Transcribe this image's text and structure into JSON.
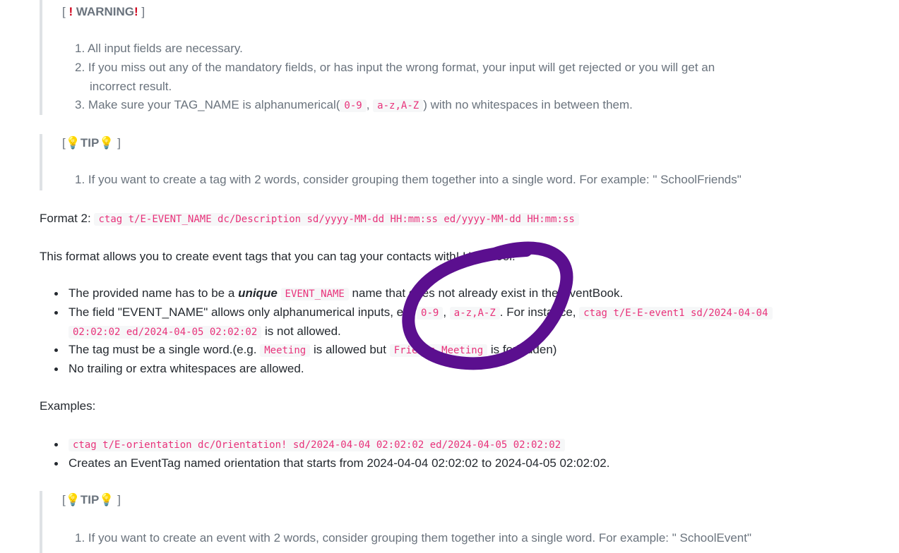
{
  "warning": {
    "title": "WARNING",
    "items": [
      "All input fields are necessary.",
      "If you miss out any of the mandatory fields, or has input the wrong format, your input will get rejected or you will get an",
      "incorrect result.",
      "Make sure your TAG_NAME is alphanumerical(",
      "0-9",
      "a-z,A-Z",
      ") with no whitespaces in between them."
    ]
  },
  "tip1": {
    "title": "TIP",
    "item": "If you want to create a tag with 2 words, consider grouping them together into a single word. For example: \" SchoolFriends\""
  },
  "format2": {
    "label": "Format 2:",
    "code": "ctag t/E-EVENT_NAME dc/Description sd/yyyy-MM-dd HH:mm:ss ed/yyyy-MM-dd HH:mm:ss"
  },
  "intro": "This format allows you to create event tags that you can tag your contacts with! How cool!",
  "bullets": {
    "b1_pre": "The provided name has to be a",
    "b1_em": "unique",
    "b1_code": "EVENT_NAME",
    "b1_post": "name that does not already exist in the EventBook.",
    "b2_pre": "The field \"EVENT_NAME\" allows only alphanumerical inputs, eg.",
    "b2_code1": "0-9",
    "b2_code2": "a-z,A-Z",
    "b2_mid": ". For instance,",
    "b2_code3": "ctag t/E-E-event1 sd/2024-04-04",
    "b2_code4": "02:02:02 ed/2024-04-05 02:02:02",
    "b2_post": "is not allowed.",
    "b3_pre": "The tag must be a single word.(e.g.",
    "b3_code1": "Meeting",
    "b3_mid": "is allowed but",
    "b3_code2": "Friends Meeting",
    "b3_post": "is forbidden)",
    "b4": "No trailing or extra whitespaces are allowed."
  },
  "examples": {
    "label": "Examples:",
    "code": "ctag t/E-orientation dc/Orientation! sd/2024-04-04 02:02:02 ed/2024-04-05 02:02:02",
    "desc": "Creates an EventTag named orientation that starts from 2024-04-04 02:02:02 to 2024-04-05 02:02:02."
  },
  "tip2": {
    "title": "TIP",
    "item": "If you want to create an event with 2 words, consider grouping them together into a single word. For example: \" SchoolEvent\""
  },
  "colors": {
    "annotation": "#5b0f8f",
    "code_text": "#e8327a",
    "warning_icon": "#d0021b"
  }
}
